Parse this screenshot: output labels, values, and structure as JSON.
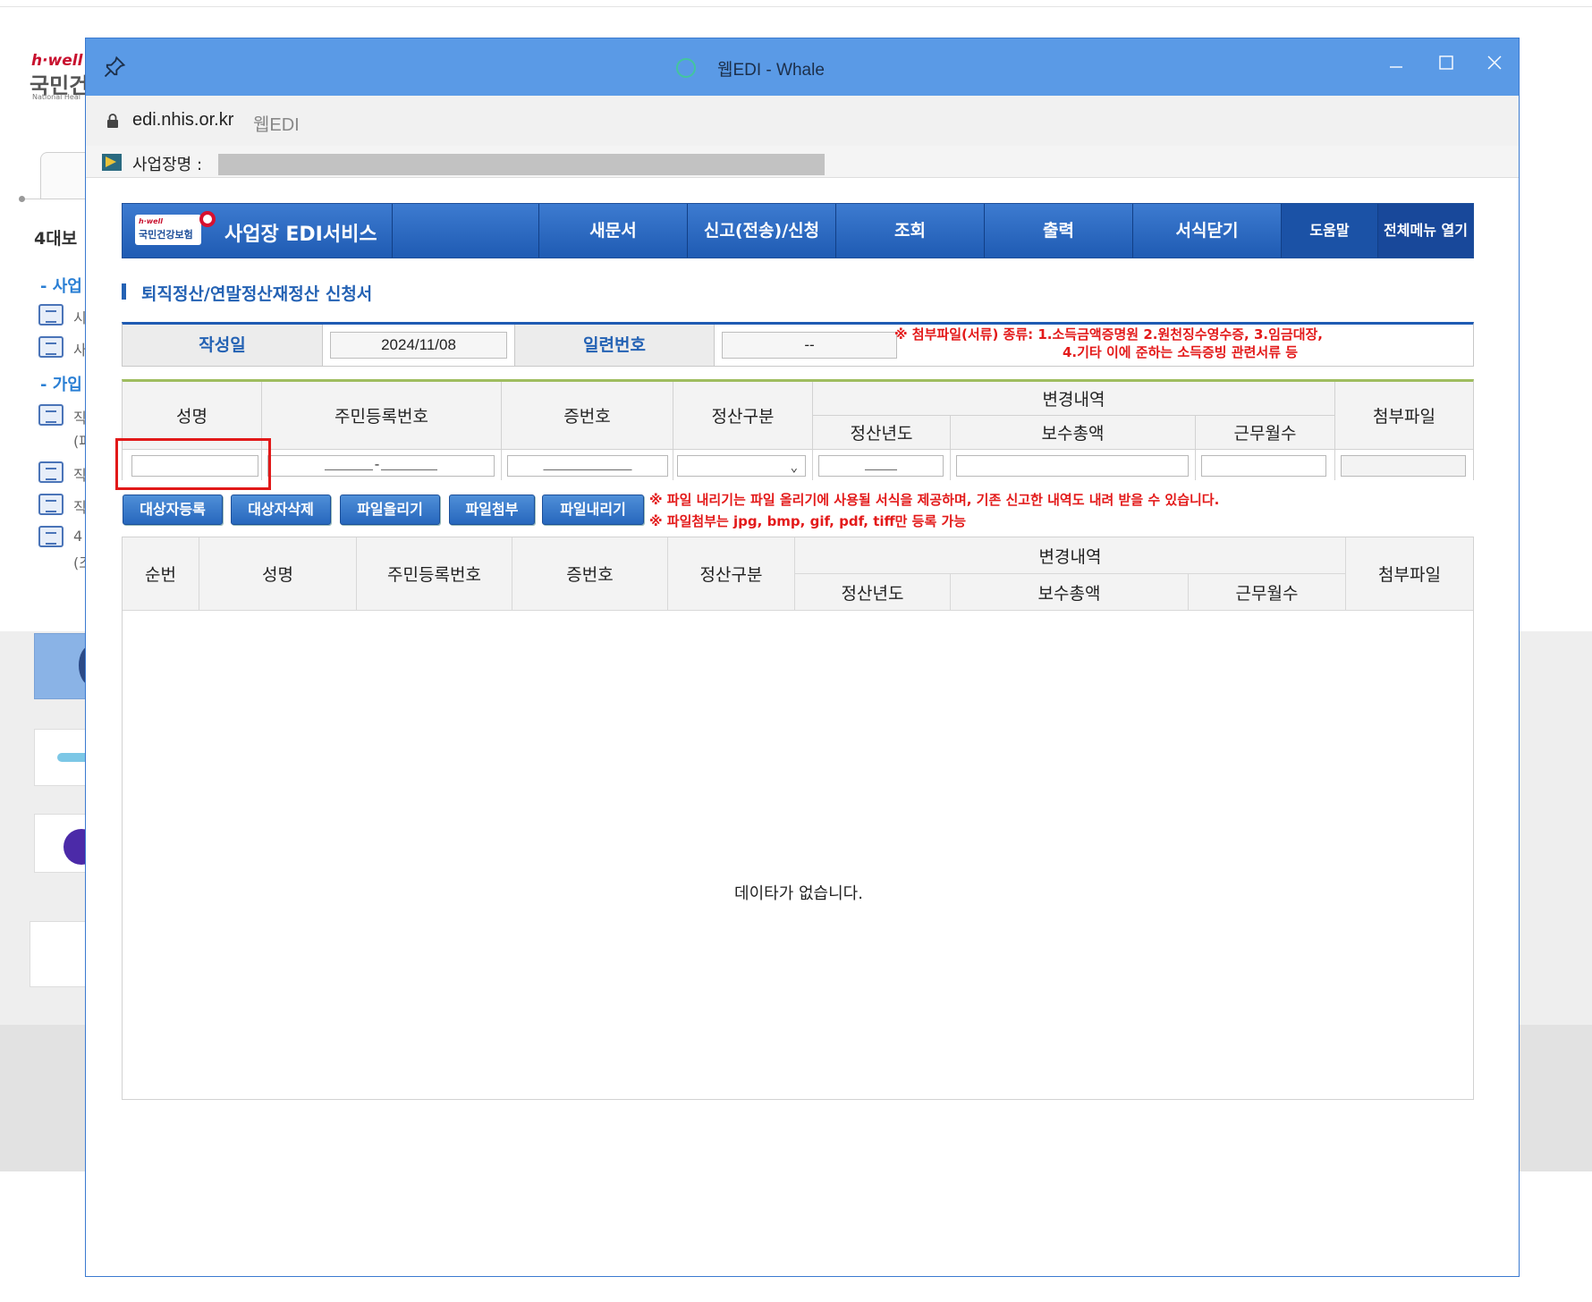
{
  "background_page": {
    "logo_sub": "h·well",
    "logo_main": "국민건",
    "logo_tiny": "National Heal",
    "sidebar_title": "4대보",
    "sections": [
      "- 사업",
      "- 가입"
    ],
    "items": [
      "시",
      "사",
      "직",
      "직",
      "직",
      "4"
    ],
    "item_sub": [
      "(파",
      "(조"
    ]
  },
  "window": {
    "title": "웹EDI - Whale",
    "url": "edi.nhis.or.kr",
    "url_title": "웹EDI"
  },
  "business": {
    "label": "사업장명 :"
  },
  "nav": {
    "brand_small": "h·well",
    "brand_logo": "국민건강보험",
    "brand": "사업장 EDI서비스",
    "items": [
      "새문서",
      "신고(전송)/신청",
      "조회",
      "출력",
      "서식닫기"
    ],
    "help": "도움말",
    "all_menu": "전체메뉴 열기"
  },
  "form": {
    "title": "퇴직정산/연말정산재정산 신청서",
    "date_label": "작성일",
    "date_value": "2024/11/08",
    "serial_label": "일련번호",
    "serial_value": "--",
    "note_line1": "※ 첨부파일(서류) 종류: 1.소득금액증명원 2.원천징수영수증, 3.임금대장,",
    "note_line2": "4.기타 이에 준하는 소득증빙 관련서류 등"
  },
  "input_table": {
    "headers": {
      "name": "성명",
      "rrn": "주민등록번호",
      "cert": "증번호",
      "type": "정산구분",
      "change": "변경내역",
      "year": "정산년도",
      "total_pay": "보수총액",
      "months": "근무월수",
      "attach": "첨부파일"
    },
    "values": {
      "name": "",
      "rrn": "______-_______",
      "cert": "___________",
      "type": "",
      "year": "____",
      "total_pay": "",
      "months": "",
      "attach": ""
    }
  },
  "buttons": [
    "대상자등록",
    "대상자삭제",
    "파일올리기",
    "파일첨부",
    "파일내리기"
  ],
  "notes": [
    "※ 파일 내리기는 파일 올리기에 사용될 서식을 제공하며, 기존 신고한 내역도 내려 받을 수 있습니다.",
    "※ 파일첨부는 jpg, bmp, gif, pdf, tiff만 등록 가능"
  ],
  "list_table": {
    "headers": {
      "seq": "순번",
      "name": "성명",
      "rrn": "주민등록번호",
      "cert": "증번호",
      "type": "정산구분",
      "change": "변경내역",
      "year": "정산년도",
      "total_pay": "보수총액",
      "months": "근무월수",
      "attach": "첨부파일"
    },
    "empty_message": "데이타가 없습니다."
  },
  "colors": {
    "titlebar": "#5a9ae6",
    "nav": "#2767bd",
    "accent": "#2462b4",
    "warning": "#e31a1a",
    "highlight_box": "#e11919"
  }
}
